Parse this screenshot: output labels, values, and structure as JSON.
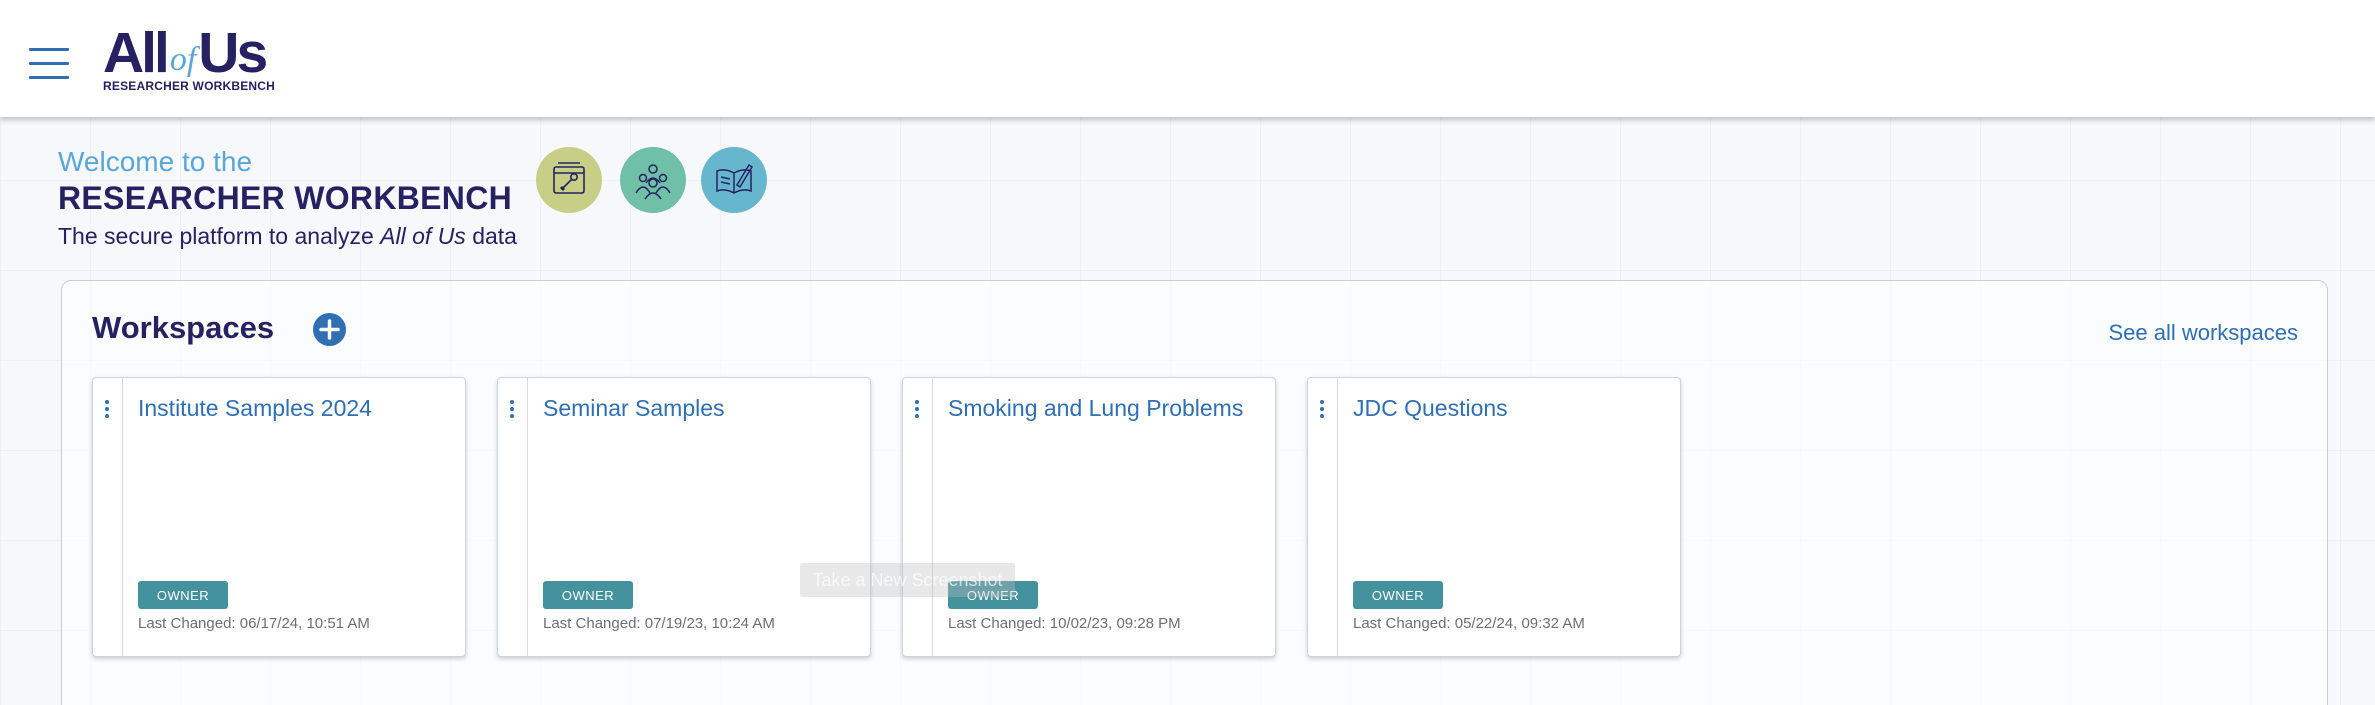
{
  "header": {
    "logo": {
      "all": "All",
      "of": "of",
      "us": "Us",
      "subtitle": "RESEARCHER WORKBENCH"
    },
    "menu_icon": "hamburger-menu-icon"
  },
  "welcome": {
    "line1": "Welcome to the",
    "line2": "RESEARCHER WORKBENCH",
    "line3_prefix": "The secure platform to analyze ",
    "line3_italic": "All of Us",
    "line3_suffix": " data"
  },
  "hero_icons": [
    {
      "name": "toolbox-icon",
      "color": "#c7cf86"
    },
    {
      "name": "people-group-icon",
      "color": "#6fc0a6"
    },
    {
      "name": "book-pencil-icon",
      "color": "#66b7cd"
    }
  ],
  "workspaces": {
    "title": "Workspaces",
    "add_icon": "plus-circle-icon",
    "see_all": "See all workspaces",
    "cards": [
      {
        "name": "Institute Samples 2024",
        "role": "OWNER",
        "last_changed": "Last Changed: 06/17/24, 10:51 AM"
      },
      {
        "name": "Seminar Samples",
        "role": "OWNER",
        "last_changed": "Last Changed: 07/19/23, 10:24 AM"
      },
      {
        "name": "Smoking and Lung Problems",
        "role": "OWNER",
        "last_changed": "Last Changed: 10/02/23, 09:28 PM"
      },
      {
        "name": "JDC Questions",
        "role": "OWNER",
        "last_changed": "Last Changed: 05/22/24, 09:32 AM"
      }
    ]
  },
  "overlay": {
    "tooltip": "Take a New Screenshot"
  },
  "colors": {
    "navy": "#262262",
    "link_blue": "#2f6fb2",
    "light_blue": "#5aa6d9",
    "badge_teal": "#45929f"
  }
}
